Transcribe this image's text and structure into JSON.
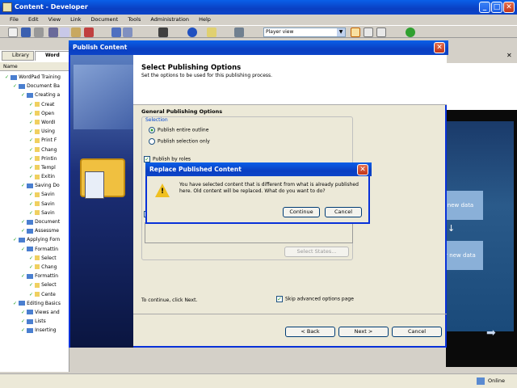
{
  "app": {
    "title": "Content - Developer",
    "menu": [
      "File",
      "Edit",
      "View",
      "Link",
      "Document",
      "Tools",
      "Administration",
      "Help"
    ],
    "view_select": "Player view",
    "left_tabs": [
      "Library",
      "Word"
    ],
    "column_header": "Name",
    "tree": [
      {
        "label": "WordPad Training",
        "indent": 0
      },
      {
        "label": "Document Ba",
        "indent": 1
      },
      {
        "label": "Creating a",
        "indent": 2
      },
      {
        "label": "Creat",
        "indent": 3
      },
      {
        "label": "Open",
        "indent": 3
      },
      {
        "label": "WordI",
        "indent": 3
      },
      {
        "label": "Using",
        "indent": 3
      },
      {
        "label": "Print F",
        "indent": 3
      },
      {
        "label": "Chang",
        "indent": 3
      },
      {
        "label": "Printin",
        "indent": 3
      },
      {
        "label": "Templ",
        "indent": 3
      },
      {
        "label": "Exitin",
        "indent": 3
      },
      {
        "label": "Saving Do",
        "indent": 2
      },
      {
        "label": "Savin",
        "indent": 3
      },
      {
        "label": "Savin",
        "indent": 3
      },
      {
        "label": "Savin",
        "indent": 3
      },
      {
        "label": "Document",
        "indent": 2
      },
      {
        "label": "Assessme",
        "indent": 2
      },
      {
        "label": "Applying Forn",
        "indent": 1
      },
      {
        "label": "Formattin",
        "indent": 2
      },
      {
        "label": "Select",
        "indent": 3
      },
      {
        "label": "Chang",
        "indent": 3
      },
      {
        "label": "Formattin",
        "indent": 2
      },
      {
        "label": "Select",
        "indent": 3
      },
      {
        "label": "Cente",
        "indent": 3
      },
      {
        "label": "Editing Basics",
        "indent": 1
      },
      {
        "label": "Views and",
        "indent": 2
      },
      {
        "label": "Lists",
        "indent": 2
      },
      {
        "label": "Inserting",
        "indent": 2
      }
    ],
    "right_panel": {
      "box1": "new data",
      "box2": "r new data"
    },
    "status": "Online"
  },
  "publish": {
    "title": "Publish Content",
    "heading": "Select Publishing Options",
    "subheading": "Set the options to be used for this publishing process.",
    "section_title": "General Publishing Options",
    "group_label": "Selection",
    "radio_entire": "Publish entire outline",
    "radio_selection": "Publish selection only",
    "publish_by_roles": "Publish by roles",
    "select_states": "Select States...",
    "continue_hint": "To continue, click Next.",
    "skip_advanced": "Skip advanced options page",
    "back": "< Back",
    "next": "Next >",
    "cancel": "Cancel"
  },
  "replace": {
    "title": "Replace Published Content",
    "message": "You have selected content that is different from what is already published here. Old content will be replaced. What do you want to do?",
    "continue": "Continue",
    "cancel": "Cancel"
  }
}
